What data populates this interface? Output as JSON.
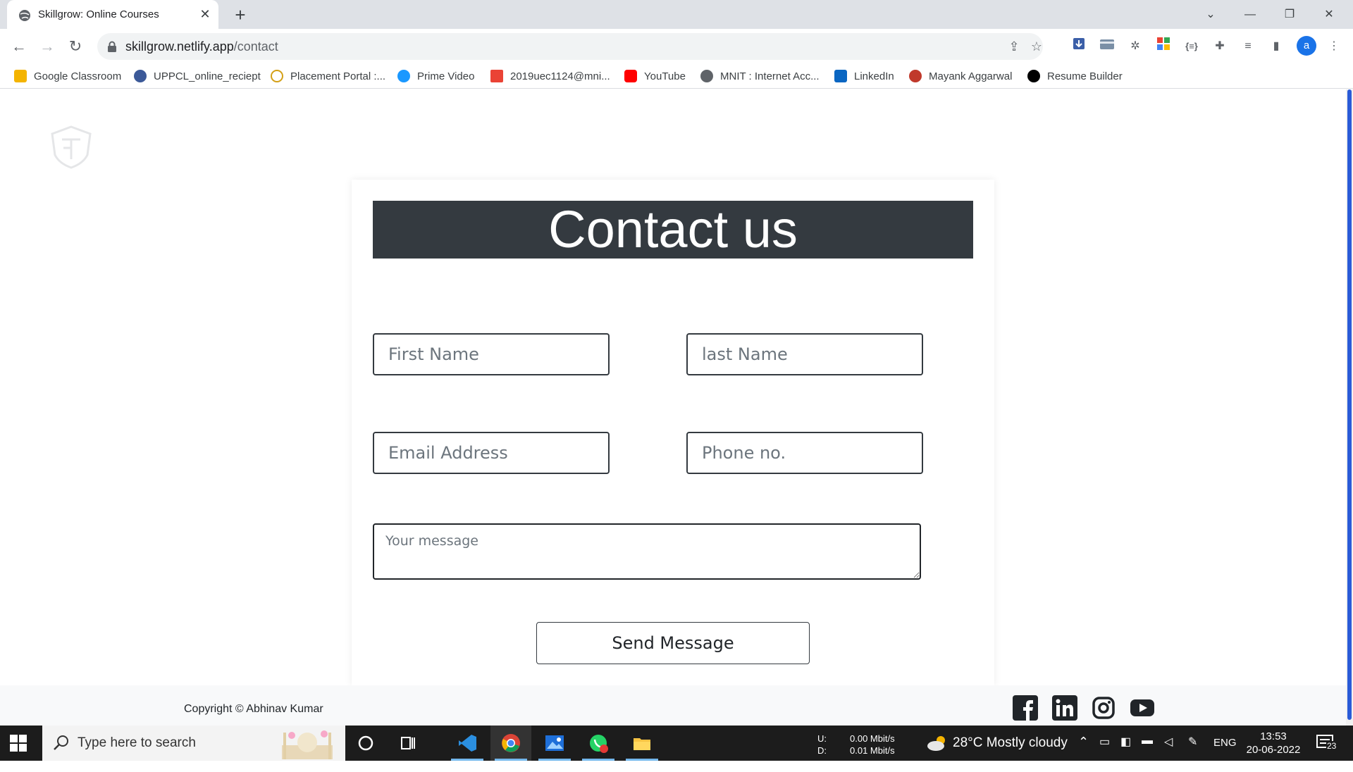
{
  "browser": {
    "tab_title": "Skillgrow: Online Courses",
    "new_tab": "+",
    "close_tab": "✕",
    "url_host": "skillgrow.netlify.app",
    "url_path": "/contact",
    "avatar_letter": "a",
    "bookmarks": [
      {
        "label": "Google Classroom",
        "color": "#f4b400"
      },
      {
        "label": "UPPCL_online_reciept",
        "color": "#3b5998"
      },
      {
        "label": "Placement Portal :...",
        "color": "#d4a017"
      },
      {
        "label": "Prime Video",
        "color": "#1a98ff"
      },
      {
        "label": "2019uec1124@mni...",
        "color": "#ea4335"
      },
      {
        "label": "YouTube",
        "color": "#ff0000"
      },
      {
        "label": "MNIT : Internet Acc...",
        "color": "#5f6368"
      },
      {
        "label": "LinkedIn",
        "color": "#0a66c2"
      },
      {
        "label": "Mayank Aggarwal",
        "color": "#c0392b"
      },
      {
        "label": "Resume Builder",
        "color": "#000000"
      }
    ]
  },
  "contact": {
    "title": "Contact us",
    "first_name_placeholder": "First Name",
    "last_name_placeholder": "last Name",
    "email_placeholder": "Email Address",
    "phone_placeholder": "Phone no.",
    "message_placeholder": "Your message",
    "send_label": "Send Message"
  },
  "footer": {
    "copyright": "Copyright © Abhinav Kumar",
    "social_icons": [
      "facebook-icon",
      "linkedin-icon",
      "instagram-icon",
      "youtube-icon"
    ]
  },
  "taskbar": {
    "search_placeholder": "Type here to search",
    "net_up_label": "U:",
    "net_down_label": "D:",
    "net_up": "0.00 Mbit/s",
    "net_down": "0.01 Mbit/s",
    "weather": "28°C  Mostly cloudy",
    "language": "ENG",
    "time": "13:53",
    "date": "20-06-2022",
    "notifications": "23"
  },
  "colors": {
    "banner": "#343a40",
    "scroll_thumb": "#2a5bd7",
    "taskbar": "#1c1c1c"
  }
}
